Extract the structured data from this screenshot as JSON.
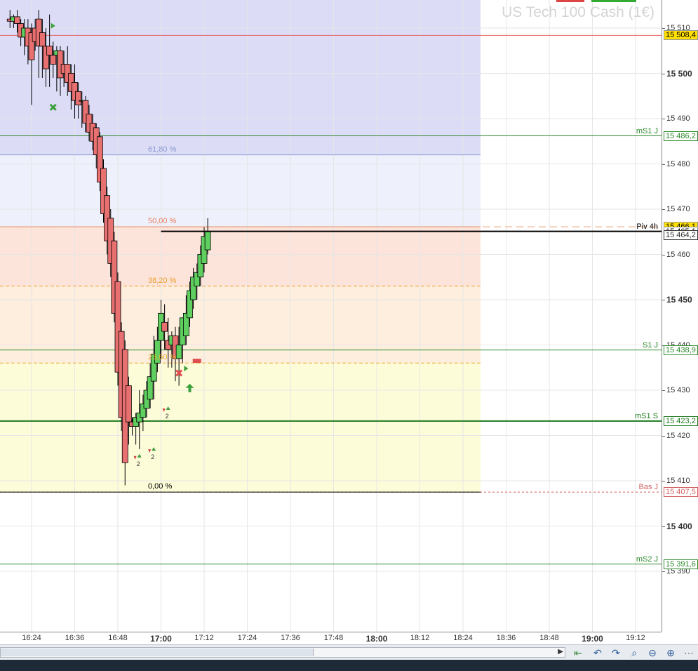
{
  "title": "US Tech 100 Cash (1€)",
  "price_axis_ticks": [
    {
      "value": 15510,
      "label": "15 510",
      "bold": false
    },
    {
      "value": 15500,
      "label": "15 500",
      "bold": true
    },
    {
      "value": 15490,
      "label": "15 490",
      "bold": false
    },
    {
      "value": 15480,
      "label": "15 480",
      "bold": false
    },
    {
      "value": 15470,
      "label": "15 470",
      "bold": false
    },
    {
      "value": 15460,
      "label": "15 460",
      "bold": false
    },
    {
      "value": 15450,
      "label": "15 450",
      "bold": true
    },
    {
      "value": 15440,
      "label": "15 440",
      "bold": false
    },
    {
      "value": 15430,
      "label": "15 430",
      "bold": false
    },
    {
      "value": 15420,
      "label": "15 420",
      "bold": false
    },
    {
      "value": 15410,
      "label": "15 410",
      "bold": false
    },
    {
      "value": 15400,
      "label": "15 400",
      "bold": true
    },
    {
      "value": 15390,
      "label": "15 390",
      "bold": false
    }
  ],
  "time_axis_ticks": [
    {
      "t": 0,
      "label": "16:24",
      "bold": false
    },
    {
      "t": 12,
      "label": "16:36",
      "bold": false
    },
    {
      "t": 24,
      "label": "16:48",
      "bold": false
    },
    {
      "t": 36,
      "label": "17:00",
      "bold": true
    },
    {
      "t": 48,
      "label": "17:12",
      "bold": false
    },
    {
      "t": 60,
      "label": "17:24",
      "bold": false
    },
    {
      "t": 72,
      "label": "17:36",
      "bold": false
    },
    {
      "t": 84,
      "label": "17:48",
      "bold": false
    },
    {
      "t": 96,
      "label": "18:00",
      "bold": true
    },
    {
      "t": 108,
      "label": "18:12",
      "bold": false
    },
    {
      "t": 120,
      "label": "18:24",
      "bold": false
    },
    {
      "t": 132,
      "label": "18:36",
      "bold": false
    },
    {
      "t": 144,
      "label": "18:48",
      "bold": false
    },
    {
      "t": 156,
      "label": "19:00",
      "bold": true
    },
    {
      "t": 168,
      "label": "19:12",
      "bold": false
    }
  ],
  "levels": [
    {
      "name": "",
      "price": 15508.4,
      "price_label": "15 508,4",
      "color": "#e86060",
      "style": "solid",
      "badge_bg": "#ffe000",
      "badge_color": "#000000"
    },
    {
      "name": "mS1 J",
      "price": 15486.2,
      "price_label": "15 486,2",
      "color": "#2e8b2e",
      "style": "solid",
      "badge_bg": "#ffffff",
      "badge_color": "#2e8b2e"
    },
    {
      "name": "",
      "price": 15466.1,
      "price_label": "15 466,1",
      "color": "#e8a070",
      "style": "dashed",
      "badge_bg": "#ffe000",
      "badge_color": "#000000"
    },
    {
      "name": "Piv 4h",
      "price": 15465.1,
      "price_label": "15 465,1",
      "color": "#000000",
      "style": "solid",
      "badge_bg": "#ffffff",
      "badge_color": "#000000"
    },
    {
      "name": "",
      "price": 15464.2,
      "price_label": "15 464,2",
      "color": "#888888",
      "style": "none",
      "badge_bg": "#ffffff",
      "badge_color": "#333333"
    },
    {
      "name": "S1 J",
      "price": 15438.9,
      "price_label": "15 438,9",
      "color": "#2e8b2e",
      "style": "solid",
      "badge_bg": "#ffffff",
      "badge_color": "#2e8b2e"
    },
    {
      "name": "mS1 S",
      "price": 15423.2,
      "price_label": "15 423,2",
      "color": "#1f7a1f",
      "style": "solid",
      "badge_bg": "#ffffff",
      "badge_color": "#1f7a1f"
    },
    {
      "name": "Bas J",
      "price": 15407.5,
      "price_label": "15 407,5",
      "color": "#d06060",
      "style": "dotted",
      "badge_bg": "#ffffff",
      "badge_color": "#d06060"
    },
    {
      "name": "mS2 J",
      "price": 15391.6,
      "price_label": "15 391,6",
      "color": "#2e8b2e",
      "style": "solid",
      "badge_bg": "#ffffff",
      "badge_color": "#2e8b2e"
    }
  ],
  "fibonacci": [
    {
      "label": "61,80 %",
      "price": 15482.0,
      "color": "#8a9ad0"
    },
    {
      "label": "50,00 %",
      "price": 15466.1,
      "color": "#e88060"
    },
    {
      "label": "38,20 %",
      "price": 15453.0,
      "color": "#e8a030"
    },
    {
      "label": "23,60 %",
      "price": 15436.0,
      "color": "#e8b030"
    },
    {
      "label": "0,00 %",
      "price": 15407.5,
      "color": "#000000"
    }
  ],
  "chart_data": {
    "type": "candlestick",
    "title": "US Tech 100 Cash (1€)",
    "timeframe_minutes": 1,
    "ylim": [
      15373,
      15512
    ],
    "xlim_labels": [
      "16:24",
      "19:12"
    ],
    "grid": true,
    "candles": [
      {
        "t": -6,
        "o": 15512,
        "h": 15514,
        "l": 15510,
        "c": 15511.5
      },
      {
        "t": -5,
        "o": 15511.5,
        "h": 15513,
        "l": 15510,
        "c": 15512.5
      },
      {
        "t": -4,
        "o": 15512.5,
        "h": 15514,
        "l": 15509,
        "c": 15511
      },
      {
        "t": -3,
        "o": 15511,
        "h": 15512,
        "l": 15506,
        "c": 15508
      },
      {
        "t": -2,
        "o": 15508,
        "h": 15512,
        "l": 15504,
        "c": 15510
      },
      {
        "t": -1,
        "o": 15510,
        "h": 15512,
        "l": 15502,
        "c": 15506
      },
      {
        "t": 0,
        "o": 15509,
        "h": 15511,
        "l": 15493,
        "c": 15503
      },
      {
        "t": 1,
        "o": 15510,
        "h": 15512,
        "l": 15505,
        "c": 15507
      },
      {
        "t": 2,
        "o": 15512,
        "h": 15514,
        "l": 15499,
        "c": 15506
      },
      {
        "t": 3,
        "o": 15509,
        "h": 15512,
        "l": 15499,
        "c": 15506
      },
      {
        "t": 4,
        "o": 15506,
        "h": 15510,
        "l": 15497,
        "c": 15501
      },
      {
        "t": 5,
        "o": 15506,
        "h": 15513,
        "l": 15497,
        "c": 15504
      },
      {
        "t": 6,
        "o": 15504,
        "h": 15507,
        "l": 15499,
        "c": 15502
      },
      {
        "t": 7,
        "o": 15504,
        "h": 15506,
        "l": 15496,
        "c": 15505
      },
      {
        "t": 8,
        "o": 15505,
        "h": 15506,
        "l": 15495,
        "c": 15499
      },
      {
        "t": 9,
        "o": 15502,
        "h": 15505,
        "l": 15497,
        "c": 15500
      },
      {
        "t": 10,
        "o": 15502,
        "h": 15506,
        "l": 15495,
        "c": 15498
      },
      {
        "t": 11,
        "o": 15500,
        "h": 15502,
        "l": 15492,
        "c": 15496
      },
      {
        "t": 12,
        "o": 15498,
        "h": 15502,
        "l": 15490,
        "c": 15494
      },
      {
        "t": 13,
        "o": 15496,
        "h": 15498,
        "l": 15490,
        "c": 15493
      },
      {
        "t": 14,
        "o": 15494,
        "h": 15496,
        "l": 15488,
        "c": 15494
      },
      {
        "t": 15,
        "o": 15494,
        "h": 15495,
        "l": 15487,
        "c": 15489
      },
      {
        "t": 16,
        "o": 15491,
        "h": 15493,
        "l": 15485,
        "c": 15487
      },
      {
        "t": 17,
        "o": 15489,
        "h": 15491,
        "l": 15483,
        "c": 15485
      },
      {
        "t": 18,
        "o": 15488,
        "h": 15489,
        "l": 15479,
        "c": 15482
      },
      {
        "t": 19,
        "o": 15486,
        "h": 15487,
        "l": 15474,
        "c": 15476
      },
      {
        "t": 20,
        "o": 15479,
        "h": 15481,
        "l": 15467,
        "c": 15469
      },
      {
        "t": 21,
        "o": 15473,
        "h": 15475,
        "l": 15460,
        "c": 15463
      },
      {
        "t": 22,
        "o": 15468,
        "h": 15470,
        "l": 15455,
        "c": 15458
      },
      {
        "t": 23,
        "o": 15463,
        "h": 15465,
        "l": 15445,
        "c": 15447
      },
      {
        "t": 24,
        "o": 15454,
        "h": 15456,
        "l": 15431,
        "c": 15434
      },
      {
        "t": 25,
        "o": 15443,
        "h": 15445,
        "l": 15421,
        "c": 15424
      },
      {
        "t": 26,
        "o": 15439,
        "h": 15441,
        "l": 15409,
        "c": 15414
      },
      {
        "t": 27,
        "o": 15431,
        "h": 15433,
        "l": 15418,
        "c": 15423
      },
      {
        "t": 28,
        "o": 15423,
        "h": 15424,
        "l": 15420,
        "c": 15422
      },
      {
        "t": 29,
        "o": 15422,
        "h": 15425,
        "l": 15418,
        "c": 15424
      },
      {
        "t": 30,
        "o": 15423,
        "h": 15430,
        "l": 15417,
        "c": 15425
      },
      {
        "t": 31,
        "o": 15424,
        "h": 15429,
        "l": 15421,
        "c": 15427
      },
      {
        "t": 32,
        "o": 15426,
        "h": 15432,
        "l": 15424,
        "c": 15430
      },
      {
        "t": 33,
        "o": 15428,
        "h": 15436,
        "l": 15426,
        "c": 15433
      },
      {
        "t": 34,
        "o": 15432,
        "h": 15442,
        "l": 15428,
        "c": 15438
      },
      {
        "t": 35,
        "o": 15436,
        "h": 15444,
        "l": 15434,
        "c": 15441
      },
      {
        "t": 36,
        "o": 15441,
        "h": 15450,
        "l": 15437,
        "c": 15447
      },
      {
        "t": 37,
        "o": 15445,
        "h": 15449,
        "l": 15439,
        "c": 15443
      },
      {
        "t": 38,
        "o": 15441,
        "h": 15446,
        "l": 15435,
        "c": 15439
      },
      {
        "t": 39,
        "o": 15440,
        "h": 15443,
        "l": 15435,
        "c": 15442
      },
      {
        "t": 40,
        "o": 15442,
        "h": 15444,
        "l": 15432,
        "c": 15437
      },
      {
        "t": 41,
        "o": 15437,
        "h": 15444,
        "l": 15431,
        "c": 15440
      },
      {
        "t": 42,
        "o": 15440,
        "h": 15444,
        "l": 15436,
        "c": 15446
      },
      {
        "t": 43,
        "o": 15442,
        "h": 15451,
        "l": 15440,
        "c": 15447
      },
      {
        "t": 44,
        "o": 15446,
        "h": 15454,
        "l": 15444,
        "c": 15452
      },
      {
        "t": 45,
        "o": 15450,
        "h": 15457,
        "l": 15448,
        "c": 15455
      },
      {
        "t": 46,
        "o": 15453,
        "h": 15458,
        "l": 15450,
        "c": 15456
      },
      {
        "t": 47,
        "o": 15455,
        "h": 15462,
        "l": 15453,
        "c": 15460
      },
      {
        "t": 48,
        "o": 15458,
        "h": 15466,
        "l": 15456,
        "c": 15464
      },
      {
        "t": 49,
        "o": 15461,
        "h": 15468,
        "l": 15460,
        "c": 15465
      }
    ],
    "markers": [
      {
        "t": 6,
        "price": 15492.5,
        "shape": "cross",
        "color": "#3ca03c",
        "text": ""
      },
      {
        "t": 6,
        "price": 15510.5,
        "shape": "tri-right",
        "color": "#3ca03c",
        "text": ""
      },
      {
        "t": 41,
        "price": 15433.8,
        "shape": "cross",
        "color": "#e05050",
        "text": ""
      },
      {
        "t": 43,
        "price": 15434.8,
        "shape": "tri-right",
        "color": "#3ca03c",
        "text": ""
      },
      {
        "t": 44,
        "price": 15430.5,
        "shape": "arrow-up",
        "color": "#3ca03c",
        "text": ""
      },
      {
        "t": 46,
        "price": 15436.5,
        "shape": "dash",
        "color": "#e05050",
        "text": ""
      },
      {
        "t": 29,
        "price": 15415,
        "shape": "arrow-pair",
        "color": "#3ca03c",
        "text": "2"
      },
      {
        "t": 33,
        "price": 15416.5,
        "shape": "arrow-pair",
        "color": "#3ca03c",
        "text": "2"
      },
      {
        "t": 37,
        "price": 15425.5,
        "shape": "arrow-pair",
        "color": "#3ca03c",
        "text": "2"
      }
    ]
  }
}
